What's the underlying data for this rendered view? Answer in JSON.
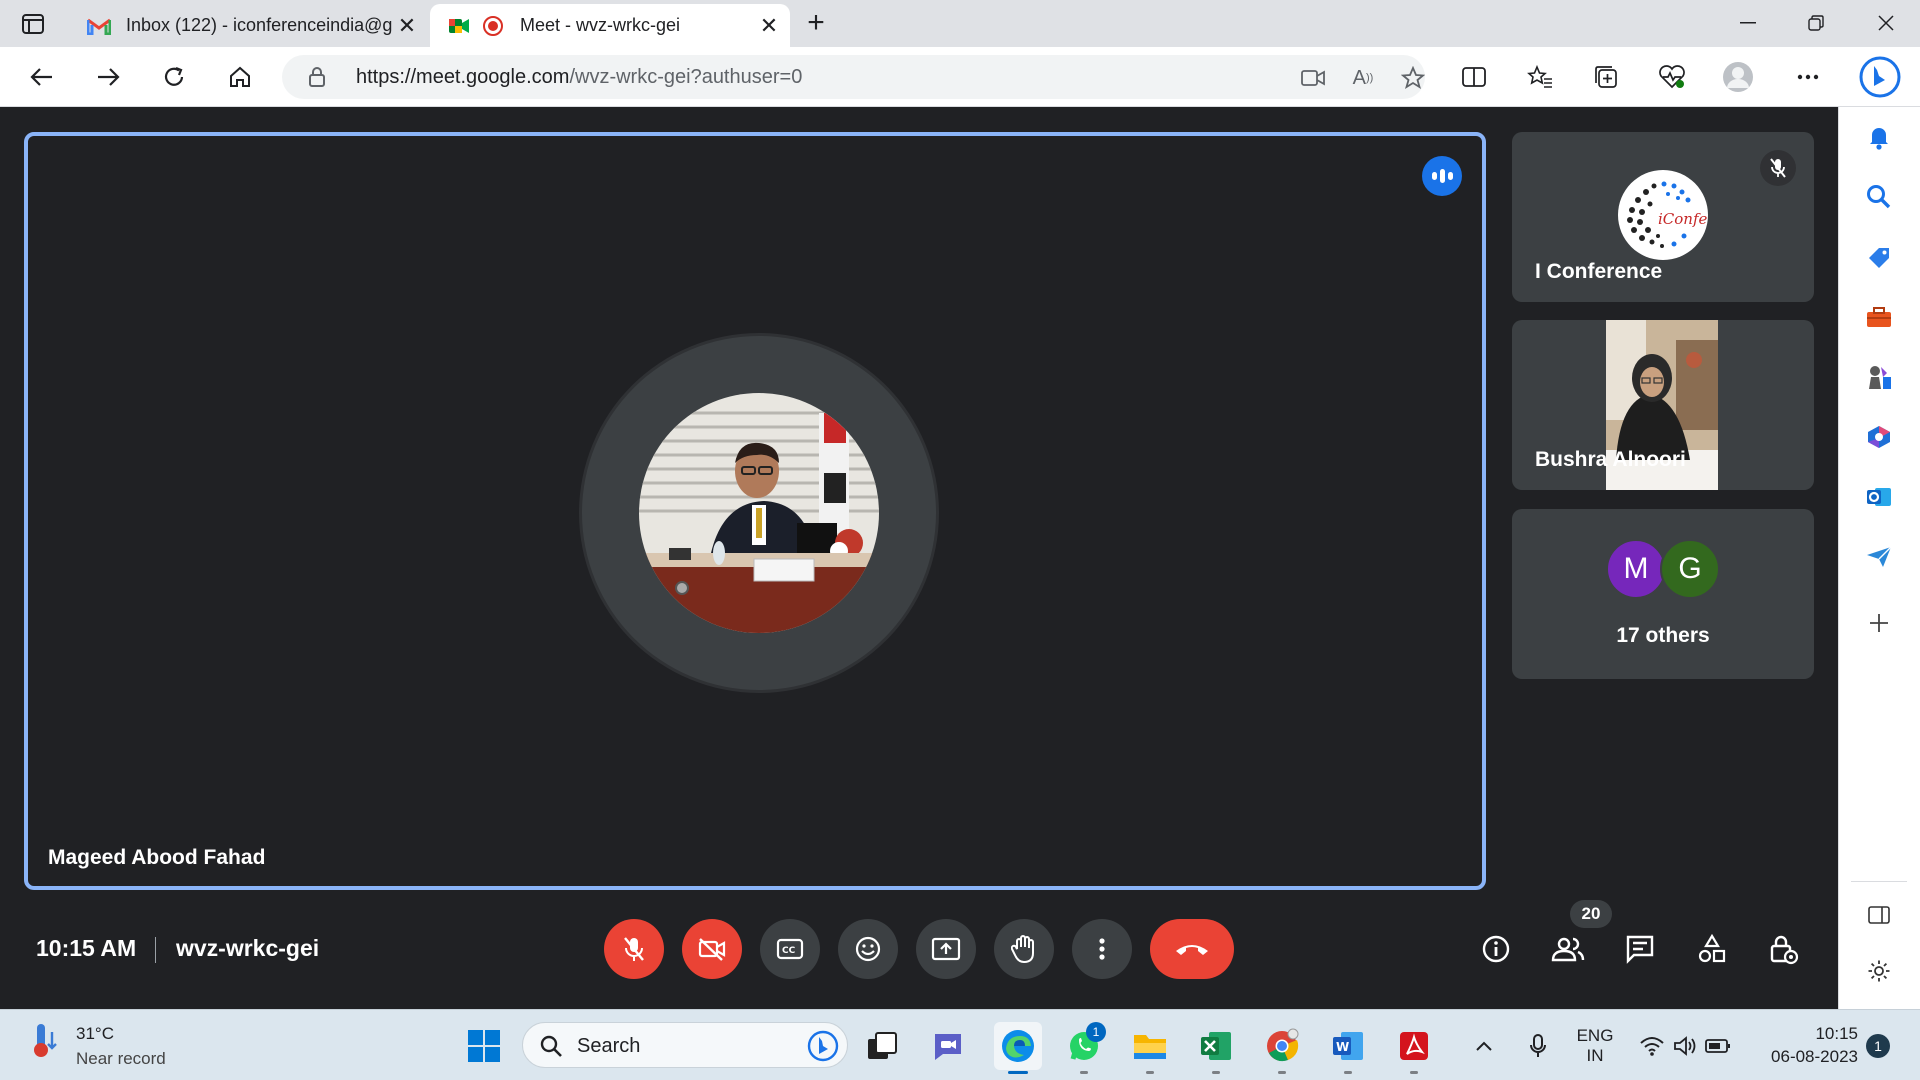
{
  "browser": {
    "tabs": [
      {
        "title": "Inbox (122) - iconferenceindia@g",
        "icon": "gmail-icon",
        "active": false
      },
      {
        "title": "Meet - wvz-wrkc-gei",
        "icon": "meet-icon",
        "active": true
      }
    ],
    "url_host": "https://meet.google.com",
    "url_path": "/wvz-wrkc-gei?authuser=0"
  },
  "meet": {
    "main_tile": {
      "name": "Mageed Abood Fahad"
    },
    "side_tiles": [
      {
        "name": "I Conference",
        "muted": true,
        "logo_text": "iConfer"
      },
      {
        "name": "Bushra Alnoori"
      }
    ],
    "others": {
      "avatars": [
        {
          "letter": "M",
          "color": "#7627bb"
        },
        {
          "letter": "G",
          "color": "#33691e"
        }
      ],
      "label": "17 others"
    },
    "time": "10:15 AM",
    "meeting_code": "wvz-wrkc-gei",
    "participant_count": "20",
    "accent": "#8ab4f8",
    "danger": "#ea4335"
  },
  "taskbar": {
    "weather_temp": "31°C",
    "weather_desc": "Near record",
    "search_label": "Search",
    "whatsapp_badge": "1",
    "lang_line1": "ENG",
    "lang_line2": "IN",
    "clock_time": "10:15",
    "clock_date": "06-08-2023",
    "notification_count": "1"
  }
}
